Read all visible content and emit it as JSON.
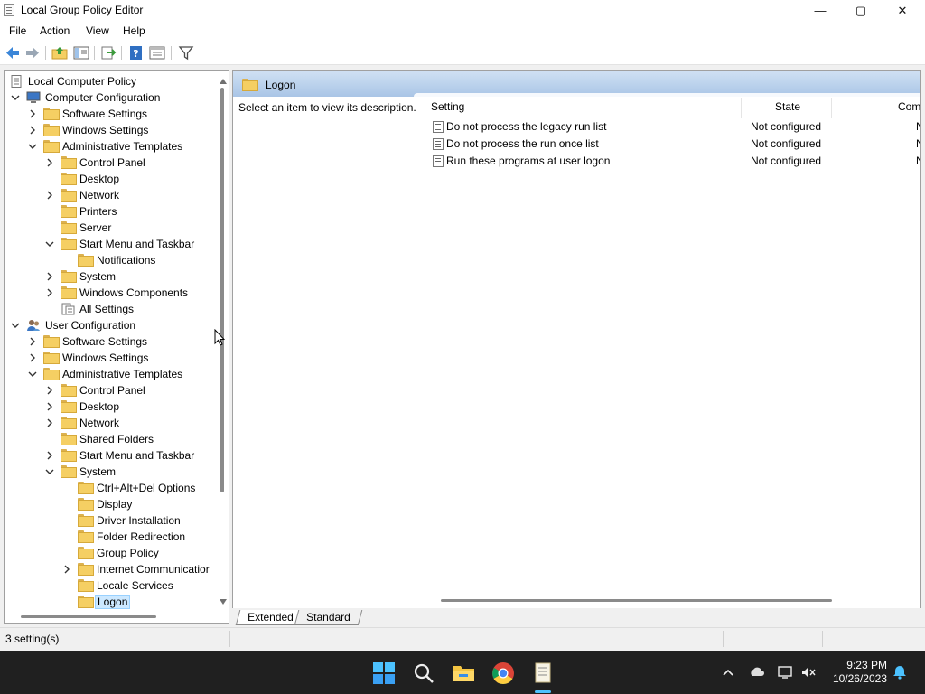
{
  "window": {
    "title": "Local Group Policy Editor"
  },
  "window_controls": {
    "minimize": "—",
    "maximize": "▢",
    "close": "✕"
  },
  "menu": [
    "File",
    "Action",
    "View",
    "Help"
  ],
  "tree": [
    {
      "label": "Local Computer Policy",
      "level": 0,
      "expander": "none",
      "icon": "policy-icon"
    },
    {
      "label": "Computer Configuration",
      "level": 1,
      "expander": "expanded",
      "icon": "computer-icon"
    },
    {
      "label": "Software Settings",
      "level": 2,
      "expander": "collapsed",
      "icon": "folder-icon"
    },
    {
      "label": "Windows Settings",
      "level": 2,
      "expander": "collapsed",
      "icon": "folder-icon"
    },
    {
      "label": "Administrative Templates",
      "level": 2,
      "expander": "expanded",
      "icon": "folder-icon"
    },
    {
      "label": "Control Panel",
      "level": 3,
      "expander": "collapsed",
      "icon": "folder-icon"
    },
    {
      "label": "Desktop",
      "level": 3,
      "expander": "none",
      "icon": "folder-icon"
    },
    {
      "label": "Network",
      "level": 3,
      "expander": "collapsed",
      "icon": "folder-icon"
    },
    {
      "label": "Printers",
      "level": 3,
      "expander": "none",
      "icon": "folder-icon"
    },
    {
      "label": "Server",
      "level": 3,
      "expander": "none",
      "icon": "folder-icon"
    },
    {
      "label": "Start Menu and Taskbar",
      "level": 3,
      "expander": "expanded",
      "icon": "folder-icon"
    },
    {
      "label": "Notifications",
      "level": 4,
      "expander": "none",
      "icon": "folder-icon"
    },
    {
      "label": "System",
      "level": 3,
      "expander": "collapsed",
      "icon": "folder-icon"
    },
    {
      "label": "Windows Components",
      "level": 3,
      "expander": "collapsed",
      "icon": "folder-icon"
    },
    {
      "label": "All Settings",
      "level": 3,
      "expander": "none",
      "icon": "all-settings-icon"
    },
    {
      "label": "User Configuration",
      "level": 1,
      "expander": "expanded",
      "icon": "user-icon"
    },
    {
      "label": "Software Settings",
      "level": 2,
      "expander": "collapsed",
      "icon": "folder-icon"
    },
    {
      "label": "Windows Settings",
      "level": 2,
      "expander": "collapsed",
      "icon": "folder-icon"
    },
    {
      "label": "Administrative Templates",
      "level": 2,
      "expander": "expanded",
      "icon": "folder-icon"
    },
    {
      "label": "Control Panel",
      "level": 3,
      "expander": "collapsed",
      "icon": "folder-icon"
    },
    {
      "label": "Desktop",
      "level": 3,
      "expander": "collapsed",
      "icon": "folder-icon"
    },
    {
      "label": "Network",
      "level": 3,
      "expander": "collapsed",
      "icon": "folder-icon"
    },
    {
      "label": "Shared Folders",
      "level": 3,
      "expander": "none",
      "icon": "folder-icon"
    },
    {
      "label": "Start Menu and Taskbar",
      "level": 3,
      "expander": "collapsed",
      "icon": "folder-icon"
    },
    {
      "label": "System",
      "level": 3,
      "expander": "expanded",
      "icon": "folder-icon"
    },
    {
      "label": "Ctrl+Alt+Del Options",
      "level": 4,
      "expander": "none",
      "icon": "folder-icon"
    },
    {
      "label": "Display",
      "level": 4,
      "expander": "none",
      "icon": "folder-icon"
    },
    {
      "label": "Driver Installation",
      "level": 4,
      "expander": "none",
      "icon": "folder-icon"
    },
    {
      "label": "Folder Redirection",
      "level": 4,
      "expander": "none",
      "icon": "folder-icon"
    },
    {
      "label": "Group Policy",
      "level": 4,
      "expander": "none",
      "icon": "folder-icon"
    },
    {
      "label": "Internet Communicatior",
      "level": 4,
      "expander": "collapsed",
      "icon": "folder-icon"
    },
    {
      "label": "Locale Services",
      "level": 4,
      "expander": "none",
      "icon": "folder-icon"
    },
    {
      "label": "Logon",
      "level": 4,
      "expander": "none",
      "icon": "folder-icon",
      "selected": true
    }
  ],
  "details": {
    "header_title": "Logon",
    "description": "Select an item to view its description.",
    "columns": {
      "setting": "Setting",
      "state": "State",
      "comment": "Com"
    },
    "rows": [
      {
        "setting": "Do not process the legacy run list",
        "state": "Not configured",
        "comment": "N"
      },
      {
        "setting": "Do not process the run once list",
        "state": "Not configured",
        "comment": "N"
      },
      {
        "setting": "Run these programs at user logon",
        "state": "Not configured",
        "comment": "N"
      }
    ]
  },
  "tabs": {
    "extended": "Extended",
    "standard": "Standard"
  },
  "status": {
    "text": "3 setting(s)"
  },
  "clock": {
    "time": "9:23 PM",
    "date": "10/26/2023"
  },
  "colors": {
    "header_gradient_top": "#cfe0f3",
    "selection": "#cce8ff",
    "taskbar": "#202020",
    "folder": "#f5cf63"
  }
}
